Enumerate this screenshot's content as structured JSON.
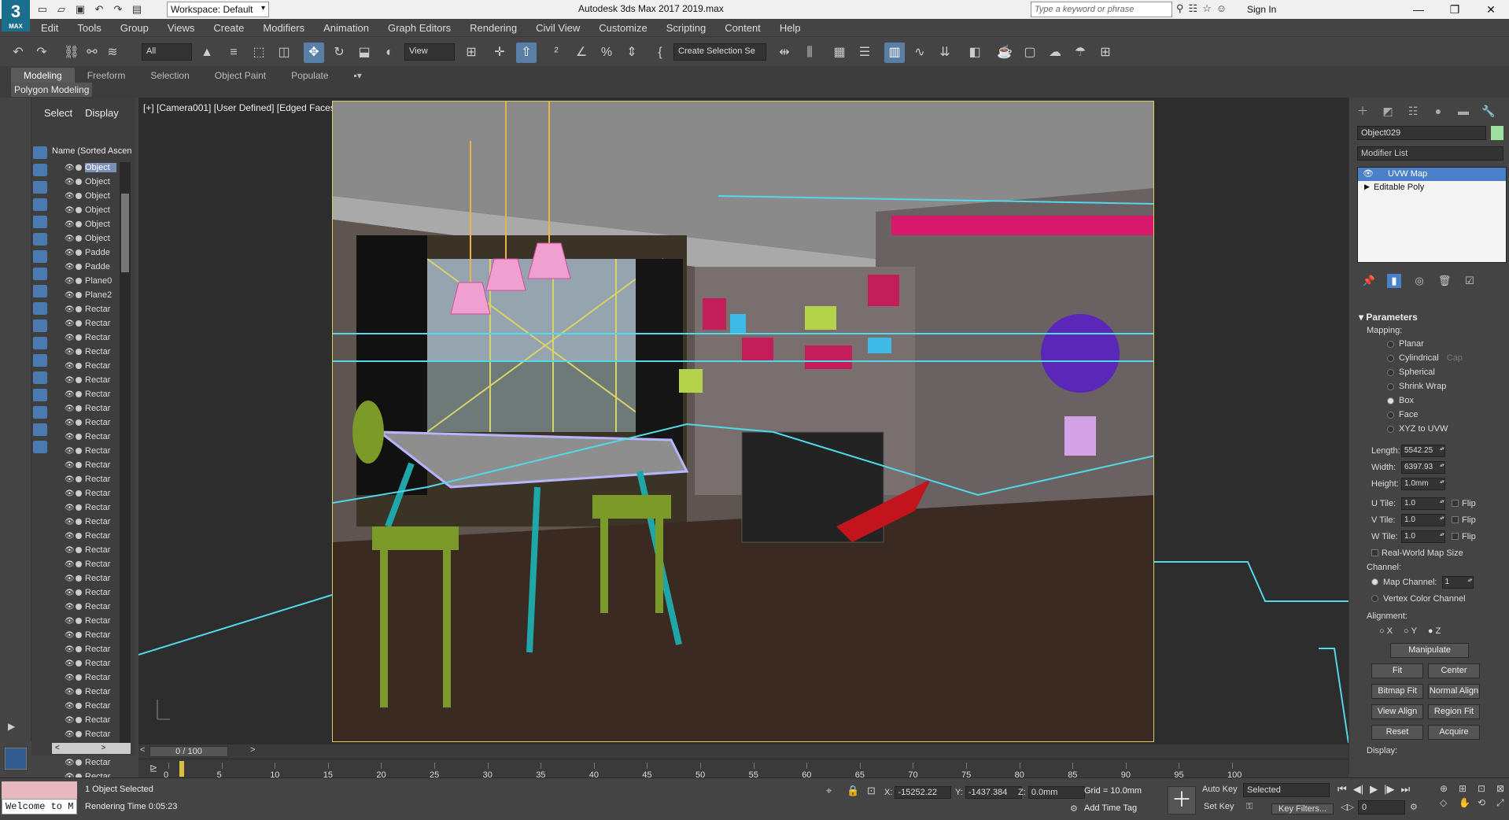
{
  "titlebar": {
    "logo": "3",
    "logo_sub": "MAX",
    "workspace": "Workspace: Default",
    "title": "Autodesk 3ds Max 2017     2019.max",
    "search_placeholder": "Type a keyword or phrase",
    "sign_in": "Sign In"
  },
  "menu": [
    "Edit",
    "Tools",
    "Group",
    "Views",
    "Create",
    "Modifiers",
    "Animation",
    "Graph Editors",
    "Rendering",
    "Civil View",
    "Customize",
    "Scripting",
    "Content",
    "Help"
  ],
  "toolbar": {
    "filter": "All",
    "view_dd": "View",
    "selection_set": "Create Selection Se"
  },
  "ribbon": {
    "tabs": [
      "Modeling",
      "Freeform",
      "Selection",
      "Object Paint",
      "Populate"
    ],
    "sub_label": "Polygon Modeling"
  },
  "scene_explorer": {
    "tab_select": "Select",
    "tab_display": "Display",
    "header": "Name (Sorted Ascen",
    "rows": [
      "Object",
      "Object",
      "Object",
      "Object",
      "Object",
      "Object",
      "Padde",
      "Padde",
      "Plane0",
      "Plane2",
      "Rectar",
      "Rectar",
      "Rectar",
      "Rectar",
      "Rectar",
      "Rectar",
      "Rectar",
      "Rectar",
      "Rectar",
      "Rectar",
      "Rectar",
      "Rectar",
      "Rectar",
      "Rectar",
      "Rectar",
      "Rectar",
      "Rectar",
      "Rectar",
      "Rectar",
      "Rectar",
      "Rectar",
      "Rectar",
      "Rectar",
      "Rectar",
      "Rectar",
      "Rectar",
      "Rectar",
      "Rectar",
      "Rectar",
      "Rectar",
      "Rectar",
      "Rectar",
      "Rectar",
      "Rectar"
    ]
  },
  "viewport": {
    "label": "[+] [Camera001] [User Defined] [Edged Faces]"
  },
  "command_panel": {
    "object_name": "Object029",
    "object_color": "#9fe09f",
    "modifier_list": "Modifier List",
    "stack": [
      "UVW Map",
      "Editable Poly"
    ],
    "rollout": "Parameters",
    "mapping_label": "Mapping:",
    "mapping_options": [
      "Planar",
      "Cylindrical",
      "Spherical",
      "Shrink Wrap",
      "Box",
      "Face",
      "XYZ to UVW"
    ],
    "mapping_selected": "Box",
    "cap_label": "Cap",
    "length_label": "Length:",
    "length": "5542.25",
    "width_label": "Width:",
    "width": "6397.93",
    "height_label": "Height:",
    "height": "1.0mm",
    "utile_label": "U Tile:",
    "utile": "1.0",
    "vtile_label": "V Tile:",
    "vtile": "1.0",
    "wtile_label": "W Tile:",
    "wtile": "1.0",
    "flip_label": "Flip",
    "real_world": "Real-World Map Size",
    "channel_label": "Channel:",
    "map_channel_label": "Map Channel:",
    "map_channel": "1",
    "vertex_color_channel": "Vertex Color Channel",
    "alignment_label": "Alignment:",
    "axes": [
      "X",
      "Y",
      "Z"
    ],
    "manipulate": "Manipulate",
    "buttons": [
      [
        "Fit",
        "Center"
      ],
      [
        "Bitmap Fit",
        "Normal Align"
      ],
      [
        "View Align",
        "Region Fit"
      ],
      [
        "Reset",
        "Acquire"
      ]
    ],
    "display_label": "Display:"
  },
  "timeline": {
    "position": "0 / 100",
    "ticks": [
      "0",
      "5",
      "10",
      "15",
      "20",
      "25",
      "30",
      "35",
      "40",
      "45",
      "50",
      "55",
      "60",
      "65",
      "70",
      "75",
      "80",
      "85",
      "90",
      "95",
      "100"
    ]
  },
  "status": {
    "listener_text": "Welcome to M",
    "selected": "1 Object Selected",
    "render_time": "Rendering Time  0:05:23",
    "x_label": "X:",
    "x": "-15252.22",
    "y_label": "Y:",
    "y": "-1437.384",
    "z_label": "Z:",
    "z": "0.0mm",
    "grid": "Grid = 10.0mm",
    "add_time_tag": "Add Time Tag",
    "auto_key": "Auto Key",
    "set_key": "Set Key",
    "selected_dd": "Selected",
    "key_filters": "Key Filters...",
    "frame": "0"
  }
}
